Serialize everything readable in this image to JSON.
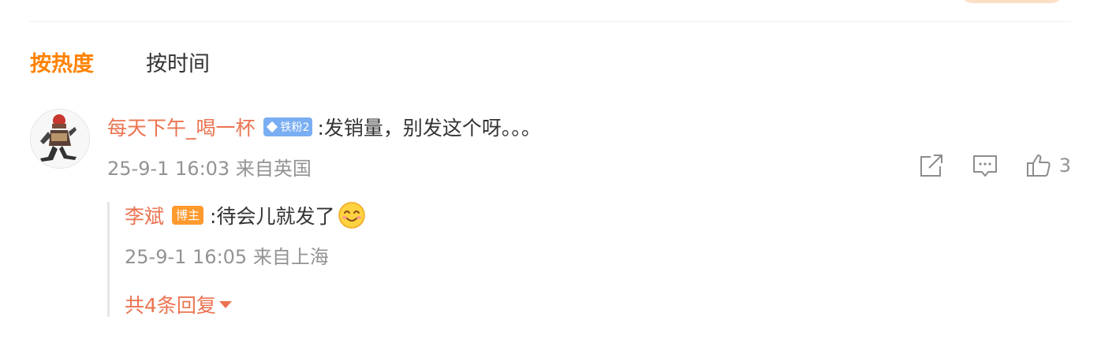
{
  "sort_tabs": {
    "hot_label": "按热度",
    "time_label": "按时间"
  },
  "comment": {
    "user_name": "每天下午_喝一杯",
    "fan_badge": "铁粉2",
    "text": ":发销量，别发这个呀。。。",
    "meta": "25-9-1 16:03 来自英国",
    "like_count": "3"
  },
  "reply": {
    "user_name": "李斌",
    "host_badge": "博主",
    "text": ":待会儿就发了",
    "meta": "25-9-1 16:05 来自上海"
  },
  "more_replies": "共4条回复",
  "icons": {
    "share": "share-icon",
    "comment": "comment-icon",
    "like": "thumbs-up-icon",
    "expand": "caret-down-icon",
    "emoji": "smile-emoji-icon"
  },
  "colors": {
    "accent": "#ff8200",
    "username": "#eb7350",
    "meta": "#939393",
    "fan_badge": "#7aaef2",
    "host_badge": "#ff9a2f"
  }
}
